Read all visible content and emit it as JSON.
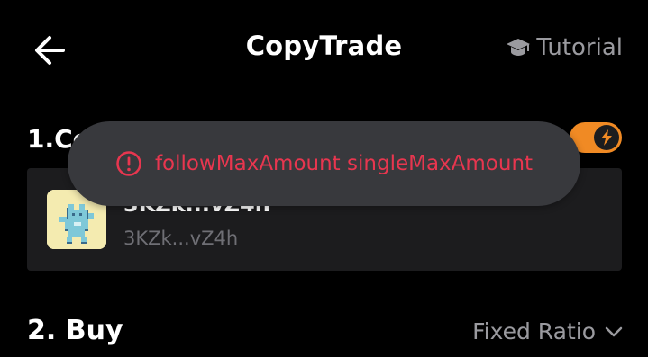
{
  "header": {
    "title": "CopyTrade",
    "tutorial_label": "Tutorial"
  },
  "section1": {
    "label": "1.Co",
    "toggle_on": true
  },
  "trader": {
    "name": "3KZk...vZ4h",
    "address": "3KZk...vZ4h"
  },
  "section2": {
    "label": "2. Buy",
    "mode_label": "Fixed Ratio"
  },
  "toast": {
    "message": "followMaxAmount singleMaxAmount",
    "color": "#e8364f"
  },
  "colors": {
    "accent": "#f08a24",
    "background": "#000000",
    "card": "#1c1c1e",
    "muted": "#9a9a9f"
  },
  "icons": {
    "back": "arrow-left-icon",
    "tutorial": "graduation-cap-icon",
    "toggle": "lightning-icon",
    "toast": "error-circle-icon",
    "dropdown": "chevron-down-icon"
  }
}
